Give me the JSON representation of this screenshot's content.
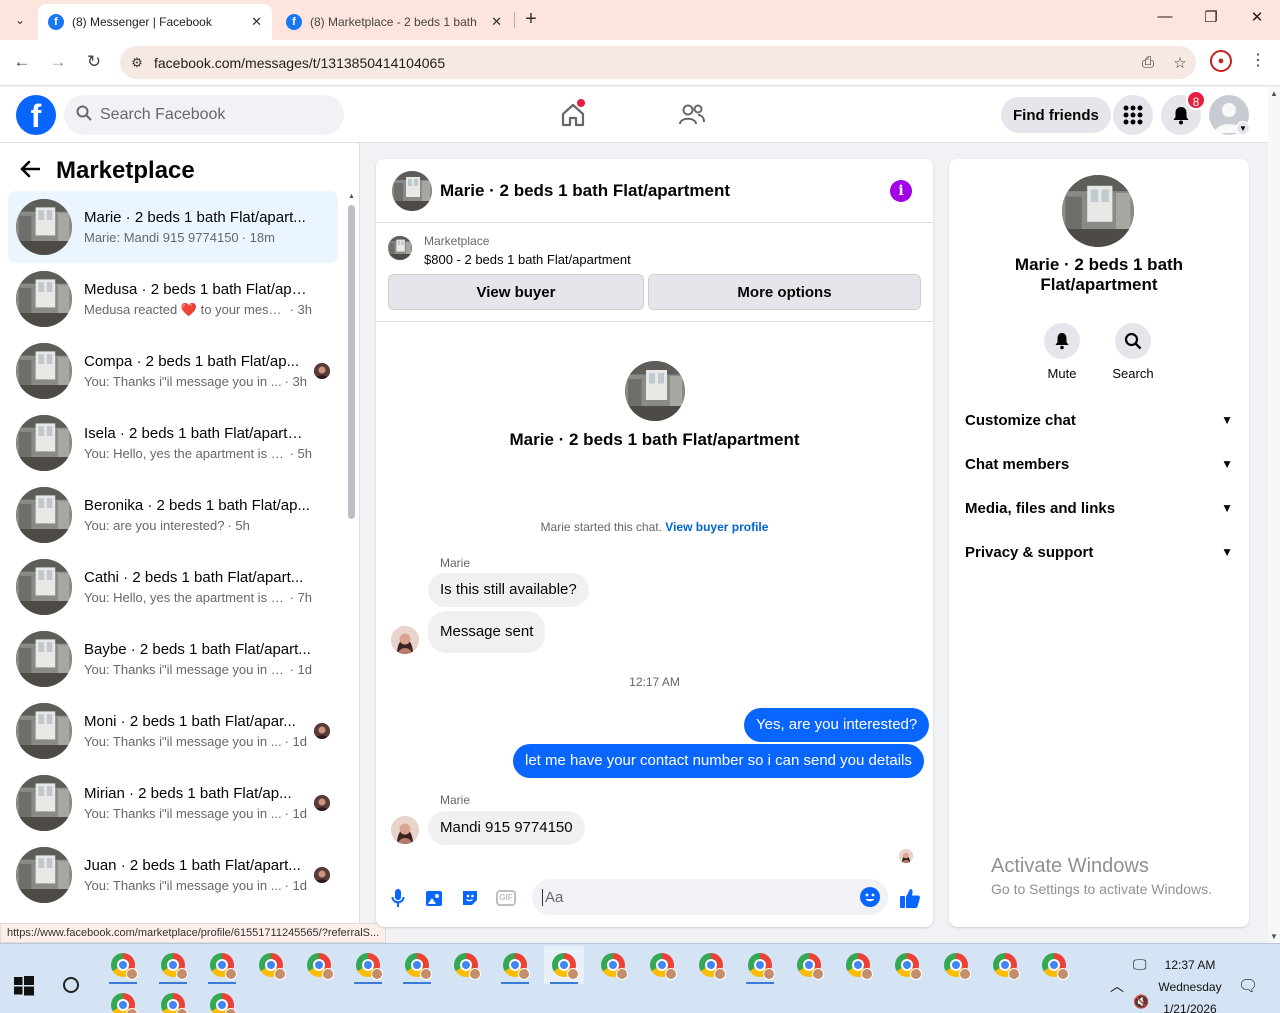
{
  "browser": {
    "tabs": [
      {
        "title": "(8) Messenger | Facebook",
        "active": true
      },
      {
        "title": "(8) Marketplace - 2 beds 1 bath",
        "active": false
      }
    ],
    "url": "facebook.com/messages/t/1313850414104065",
    "status_url": "https://www.facebook.com/marketplace/profile/61551711245565/?referralS..."
  },
  "fb_header": {
    "search_placeholder": "Search Facebook",
    "find_friends_label": "Find friends",
    "notification_count": "8"
  },
  "left": {
    "title": "Marketplace",
    "conversations": [
      {
        "name": "Marie · 2 beds 1 bath Flat/apart...",
        "snippet": "Marie: Mandi 915 9774150",
        "time": "· 18m",
        "selected": true,
        "seen": false
      },
      {
        "name": "Medusa · 2 beds 1 bath Flat/apa...",
        "snippet": "Medusa reacted ❤️ to your messa...",
        "time": "· 3h",
        "selected": false,
        "seen": false
      },
      {
        "name": "Compa · 2 beds 1 bath Flat/ap...",
        "snippet": "You: Thanks i\"il message you in ...",
        "time": "· 3h",
        "selected": false,
        "seen": true
      },
      {
        "name": "Isela · 2 beds 1 bath Flat/apartm...",
        "snippet": "You: Hello, yes the apartment is still...",
        "time": "· 5h",
        "selected": false,
        "seen": false
      },
      {
        "name": "Beronika · 2 beds 1 bath Flat/ap...",
        "snippet": "You: are you interested?",
        "time": "· 5h",
        "selected": false,
        "seen": false
      },
      {
        "name": "Cathi · 2 beds 1 bath Flat/apart...",
        "snippet": "You: Hello, yes the apartment is still...",
        "time": "· 7h",
        "selected": false,
        "seen": false
      },
      {
        "name": "Baybe · 2 beds 1 bath Flat/apart...",
        "snippet": "You: Thanks i\"il message you in a ...",
        "time": "· 1d",
        "selected": false,
        "seen": false
      },
      {
        "name": "Moni · 2 beds 1 bath Flat/apar...",
        "snippet": "You: Thanks i\"il message you in ...",
        "time": "· 1d",
        "selected": false,
        "seen": true
      },
      {
        "name": "Mirian · 2 beds 1 bath Flat/ap...",
        "snippet": "You: Thanks i\"il message you in ...",
        "time": "· 1d",
        "selected": false,
        "seen": true
      },
      {
        "name": "Juan · 2 beds 1 bath Flat/apart...",
        "snippet": "You: Thanks i\"il message you in ...",
        "time": "· 1d",
        "selected": false,
        "seen": true
      }
    ]
  },
  "chat": {
    "header_title": "Marie · 2 beds 1 bath Flat/apartment",
    "marketplace_label": "Marketplace",
    "listing": "$800 - 2 beds 1 bath Flat/apartment",
    "view_buyer_label": "View buyer",
    "more_options_label": "More options",
    "center_name": "Marie · 2 beds 1 bath Flat/apartment",
    "started_text": "Marie started this chat.",
    "view_buyer_profile": "View buyer profile",
    "sender_name": "Marie",
    "msg1": "Is this still available?",
    "msg2": "Message sent",
    "timestamp": "12:17 AM",
    "msg3": "Yes, are you interested?",
    "msg4": "let me have your contact number so i can send you details",
    "msg5": "Mandi  915 9774150",
    "composer_placeholder": "Aa"
  },
  "info_panel": {
    "name": "Marie · 2 beds 1 bath Flat/apartment",
    "mute_label": "Mute",
    "search_label": "Search",
    "sections": [
      "Customize chat",
      "Chat members",
      "Media, files and links",
      "Privacy & support"
    ]
  },
  "watermark": {
    "line1": "Activate Windows",
    "line2": "Go to Settings to activate Windows."
  },
  "taskbar": {
    "time": "12:37 AM",
    "day": "Wednesday",
    "date": "1/21/2026"
  },
  "colors": {
    "fb_blue": "#0866ff",
    "selected_row": "#ebf5ff",
    "info_purple": "#a400e8",
    "badge_red": "#e41e3f"
  }
}
